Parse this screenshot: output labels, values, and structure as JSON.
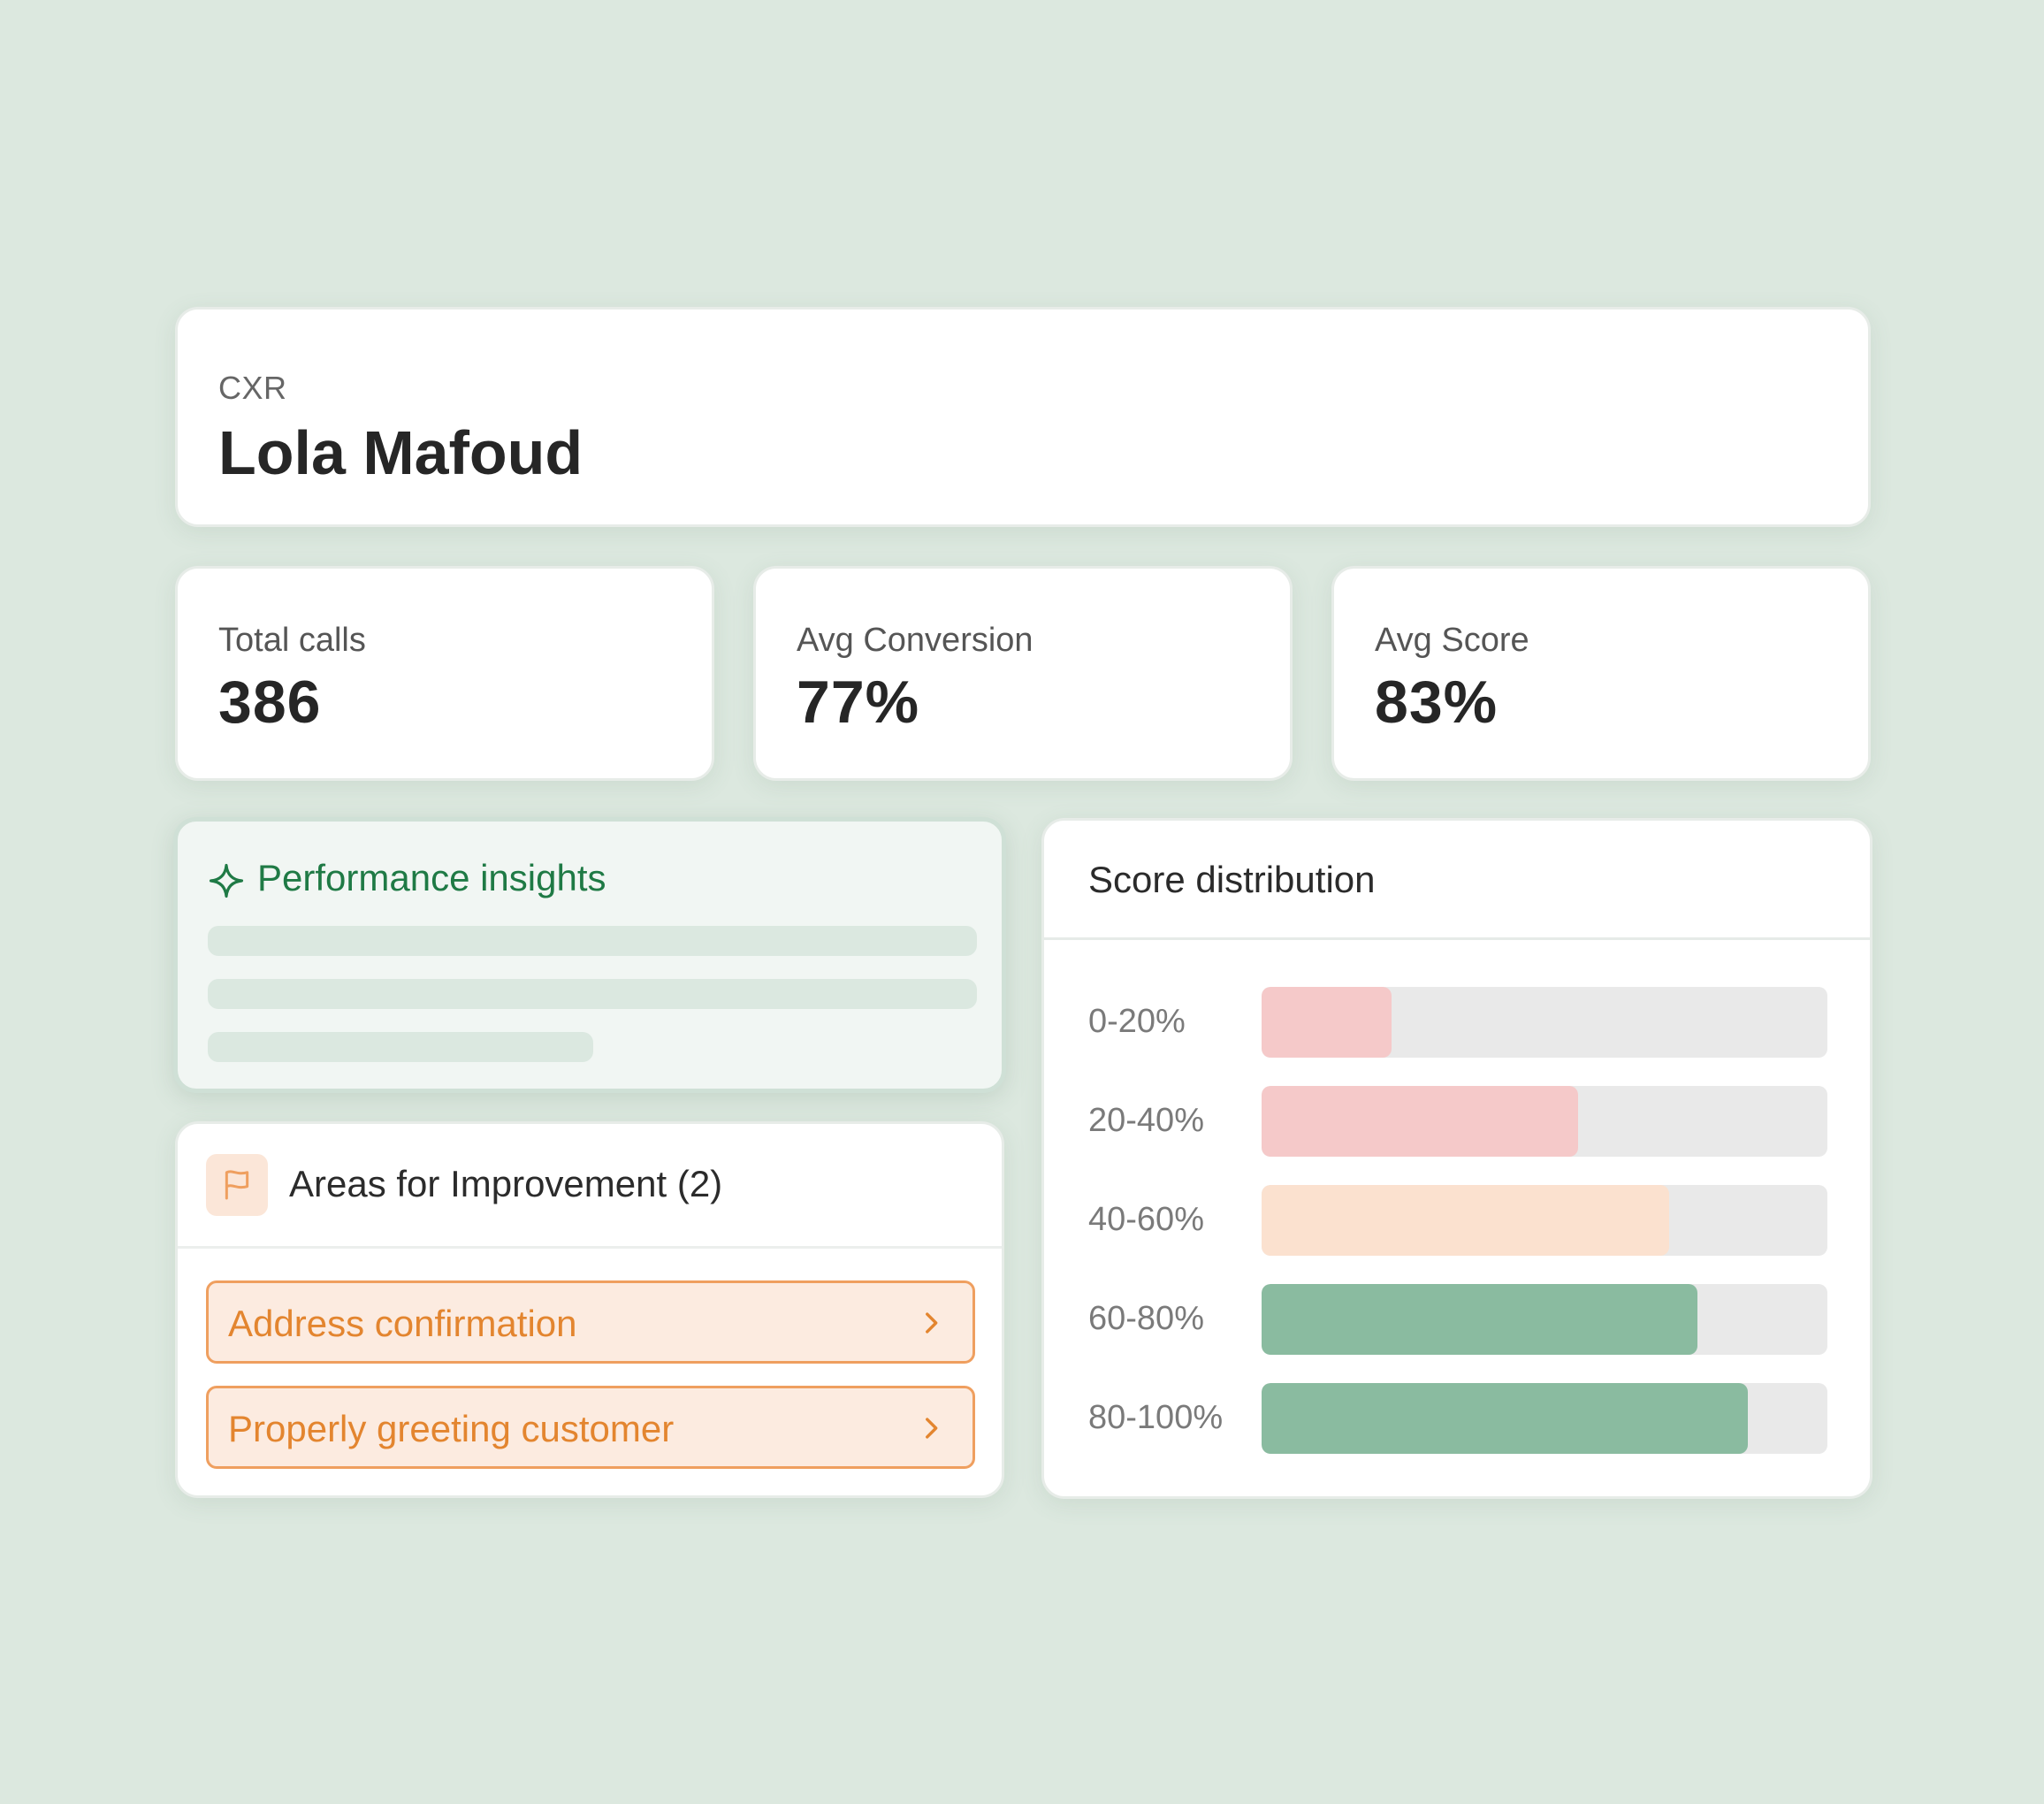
{
  "header": {
    "role": "CXR",
    "name": "Lola Mafoud"
  },
  "stats": [
    {
      "label": "Total calls",
      "value": "386"
    },
    {
      "label": "Avg Conversion",
      "value": "77%"
    },
    {
      "label": "Avg Score",
      "value": "83%"
    }
  ],
  "insights": {
    "title": "Performance insights",
    "icon": "sparkle-icon"
  },
  "improvement": {
    "title": "Areas for Improvement (2)",
    "icon": "flag-icon",
    "items": [
      {
        "label": "Address confirmation"
      },
      {
        "label": "Properly greeting customer"
      }
    ]
  },
  "score_distribution": {
    "title": "Score distribution",
    "rows": [
      {
        "label": "0-20%",
        "fraction": 0.23,
        "color": "#f5c9c9"
      },
      {
        "label": "20-40%",
        "fraction": 0.56,
        "color": "#f5c9c9"
      },
      {
        "label": "40-60%",
        "fraction": 0.72,
        "color": "#fbe1cf"
      },
      {
        "label": "60-80%",
        "fraction": 0.77,
        "color": "#8abba0"
      },
      {
        "label": "80-100%",
        "fraction": 0.86,
        "color": "#8abba0"
      }
    ]
  },
  "colors": {
    "background": "#dce8df",
    "accent_green": "#1f7a45",
    "accent_orange": "#e3852f"
  }
}
